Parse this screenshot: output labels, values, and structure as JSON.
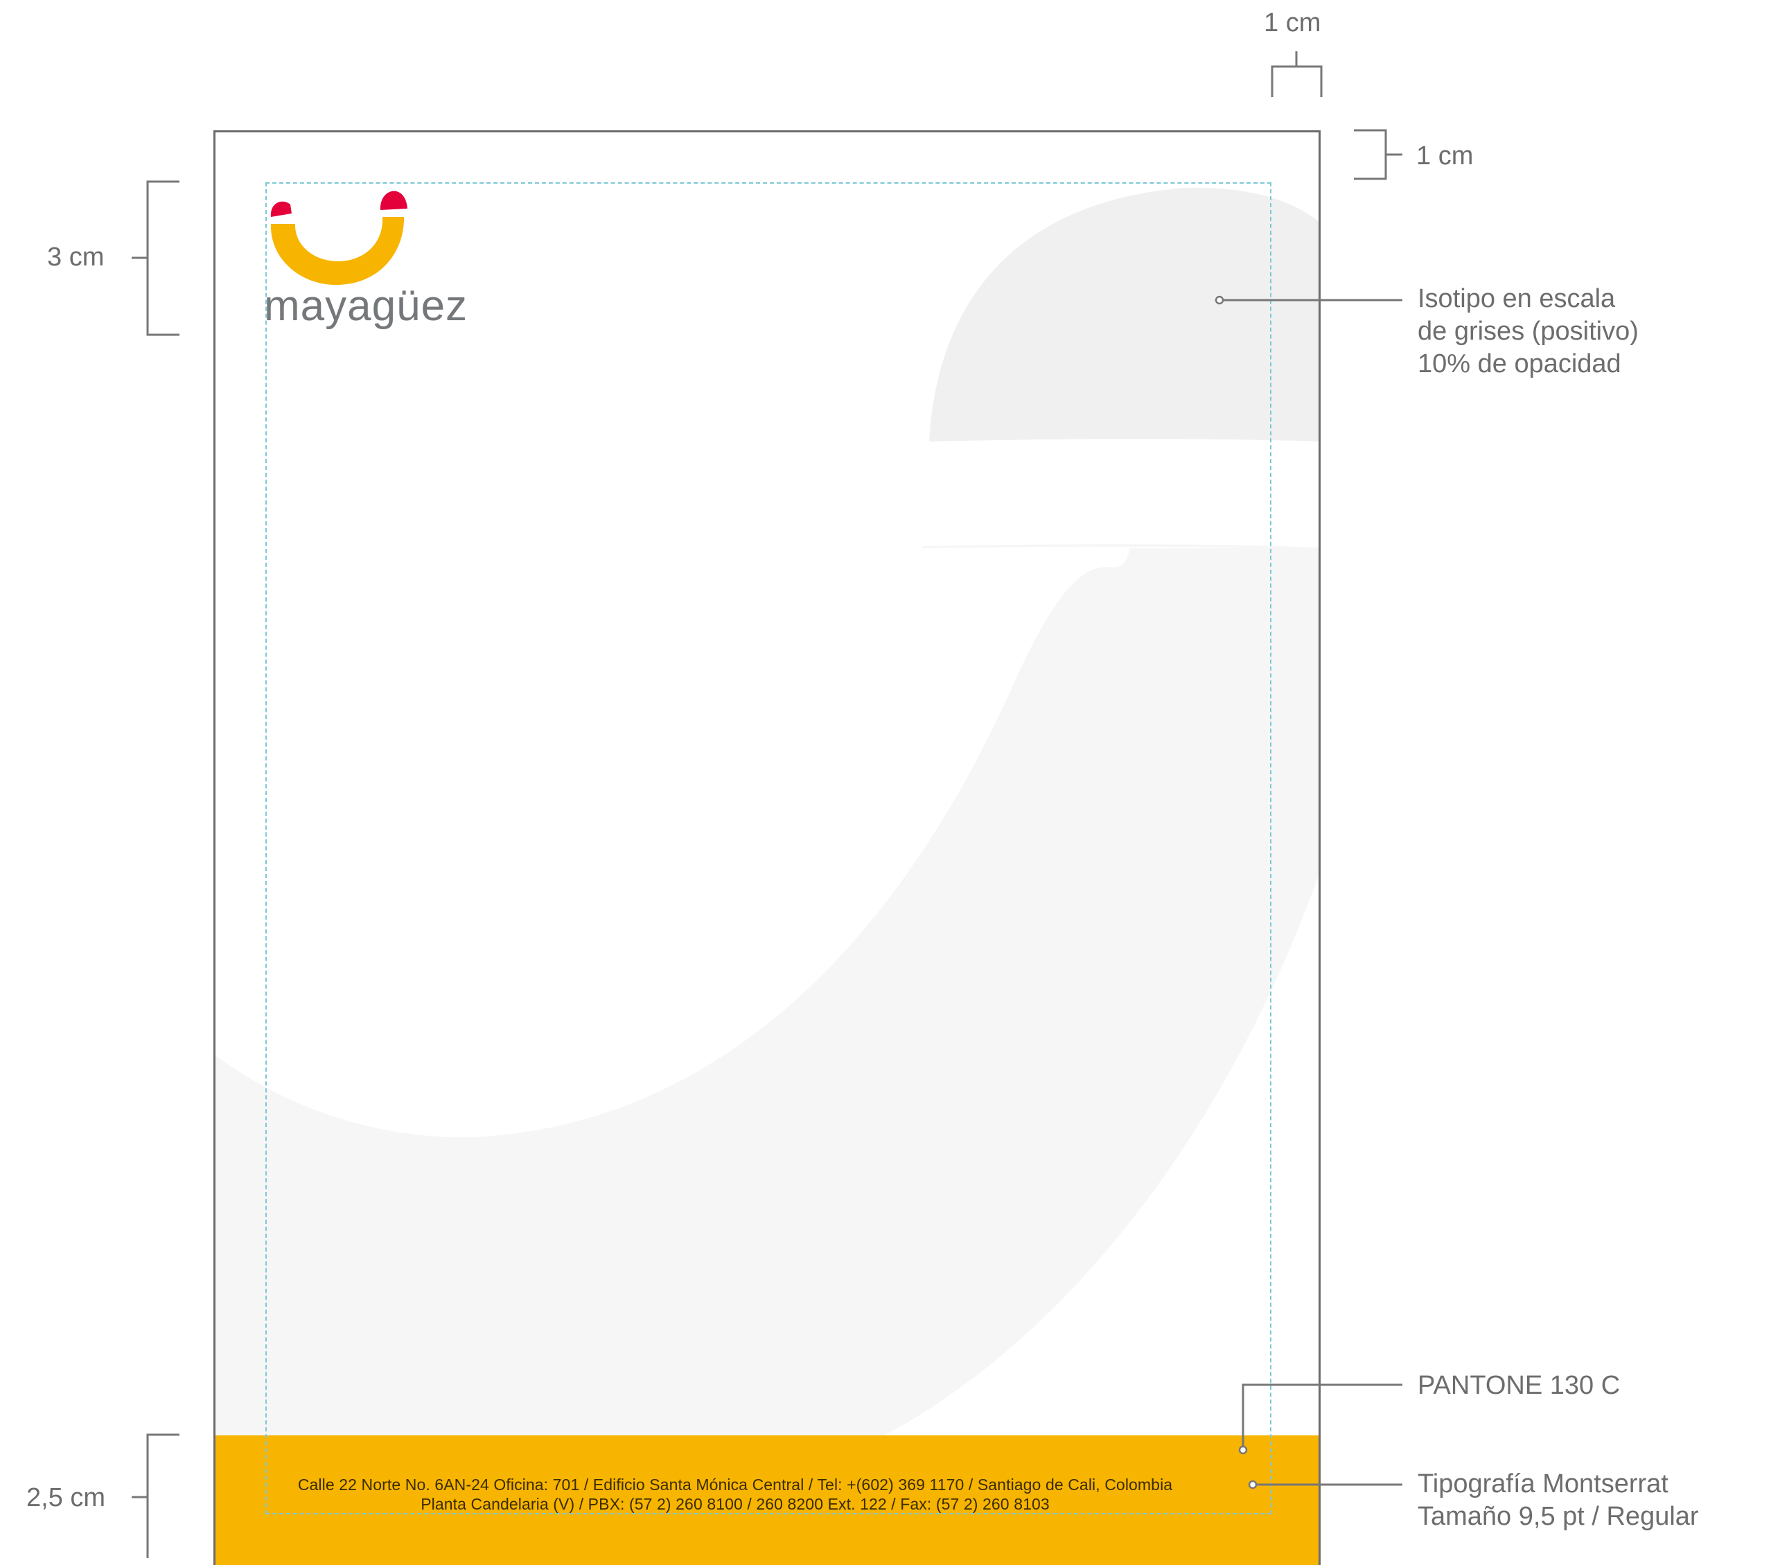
{
  "logo": {
    "wordmark": "mayagüez"
  },
  "dimensions": {
    "top_margin_width": "1 cm",
    "top_margin_height": "1 cm",
    "header_height": "3 cm",
    "footer_height": "2,5 cm"
  },
  "notes": {
    "isotipo": [
      "Isotipo en escala",
      "de grises (positivo)",
      "10% de opacidad"
    ],
    "pantone": "PANTONE 130 C",
    "typography": [
      "Tipografía Montserrat",
      "Tamaño 9,5 pt / Regular"
    ]
  },
  "footer": {
    "line1": "Calle 22 Norte No. 6AN-24 Oficina: 701 / Edificio Santa Mónica Central / Tel: +(602) 369 1170 / Santiago de Cali, Colombia",
    "line2": "Planta Candelaria (V) / PBX: (57 2) 260 8100 / 260 8200 Ext. 122 / Fax: (57 2) 260 8103"
  },
  "colors": {
    "footer_band": "#f7b400",
    "logo_yellow": "#f7b400",
    "logo_red": "#e4003a",
    "watermark_gray": "#f0f0f0",
    "guide_cyan": "#7cc8d6"
  }
}
